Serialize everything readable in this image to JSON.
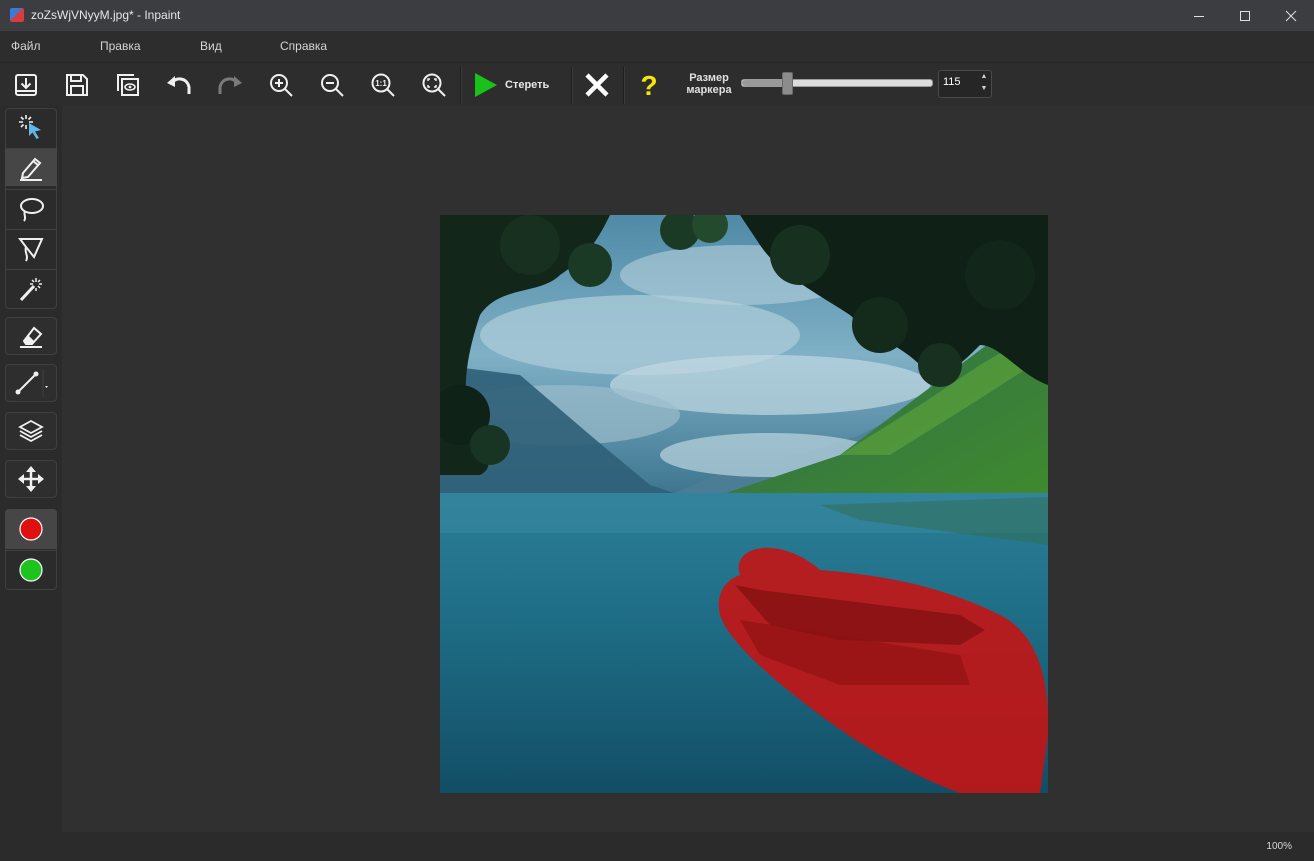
{
  "window": {
    "title": "zoZsWjVNyyM.jpg* - Inpaint",
    "minimize_icon": "minimize-icon",
    "maximize_icon": "maximize-icon",
    "close_icon": "close-icon"
  },
  "menu": {
    "items": [
      "Файл",
      "Правка",
      "Вид",
      "Справка"
    ]
  },
  "toolbar": {
    "buttons": [
      {
        "name": "open-button",
        "icon": "open-file-icon"
      },
      {
        "name": "save-button",
        "icon": "save-icon"
      },
      {
        "name": "preview-button",
        "icon": "preview-icon"
      },
      {
        "name": "undo-button",
        "icon": "undo-icon"
      },
      {
        "name": "redo-button",
        "icon": "redo-icon"
      },
      {
        "name": "zoom-in-button",
        "icon": "zoom-in-icon"
      },
      {
        "name": "zoom-out-button",
        "icon": "zoom-out-icon"
      },
      {
        "name": "zoom-1-1-button",
        "icon": "zoom-actual-icon"
      },
      {
        "name": "zoom-fit-button",
        "icon": "zoom-fit-icon"
      }
    ],
    "erase_label": "Стереть",
    "cancel_icon": "cancel-x-icon",
    "help_icon": "help-question-icon",
    "marker_size_label_line1": "Размер",
    "marker_size_label_line2": "маркера",
    "marker_size_value": "115",
    "marker_slider_fraction": 0.23
  },
  "tools": [
    {
      "name": "selection-tool",
      "icon": "magic-pointer-icon"
    },
    {
      "name": "marker-tool",
      "icon": "marker-pen-icon",
      "active": true
    },
    {
      "name": "lasso-tool",
      "icon": "lasso-icon"
    },
    {
      "name": "polygon-lasso-tool",
      "icon": "polygon-lasso-icon"
    },
    {
      "name": "magic-wand-tool",
      "icon": "magic-wand-icon"
    },
    {
      "name": "eraser-tool",
      "icon": "eraser-icon"
    },
    {
      "name": "line-tool",
      "icon": "line-icon"
    },
    {
      "name": "layers-tool",
      "icon": "layers-icon"
    },
    {
      "name": "move-tool",
      "icon": "move-arrows-icon"
    },
    {
      "name": "red-mask-color",
      "icon": "red-circle-icon",
      "color": "#e01010"
    },
    {
      "name": "green-donor-color",
      "icon": "green-circle-icon",
      "color": "#1ec41e"
    }
  ],
  "status": {
    "zoom": "100%"
  },
  "colors": {
    "accent_green": "#19c219",
    "help_yellow": "#f5e50a",
    "mask_red": "#c81212"
  }
}
